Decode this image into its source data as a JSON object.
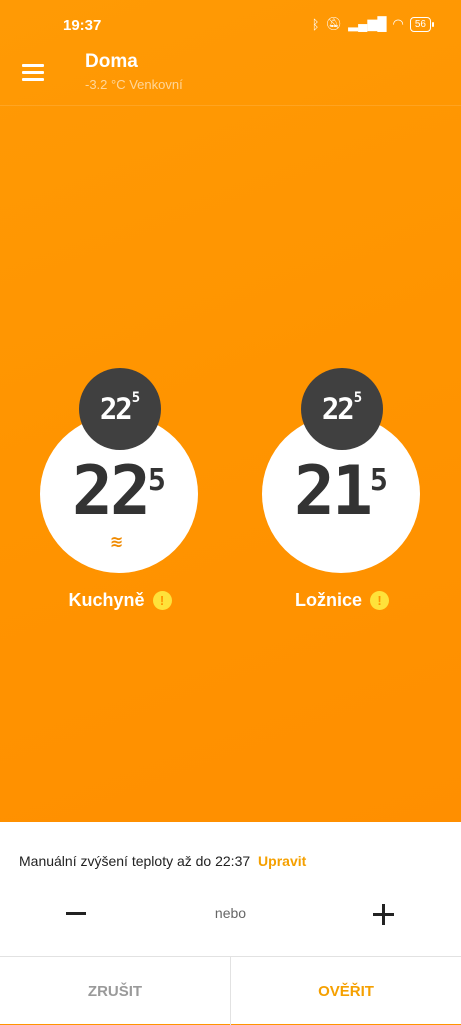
{
  "status_bar": {
    "time": "19:37",
    "icons": [
      "bluetooth-icon",
      "mute-icon",
      "signal-icon",
      "wifi-icon"
    ],
    "battery": "56"
  },
  "header": {
    "title": "Doma",
    "subtitle": "-3.2 °C Venkovní"
  },
  "rooms": [
    {
      "name": "Kuchyně",
      "target_main": "22",
      "target_decimal": "5",
      "current_main": "22",
      "current_decimal": "5",
      "heating_indicator": "≋"
    },
    {
      "name": "Ložnice",
      "target_main": "22",
      "target_decimal": "5",
      "current_main": "21",
      "current_decimal": "5"
    }
  ],
  "warning_symbol": "!",
  "panel": {
    "info_text": "Manuální zvýšení teploty až do 22:37",
    "edit_link": "Upravit",
    "or_text": "nebo",
    "cancel_label": "ZRUŠIT",
    "confirm_label": "OVĚŘIT"
  },
  "colors": {
    "accent": "#ff9400",
    "link": "#f5a000",
    "bubble": "#404040",
    "warning": "#ffe23a"
  }
}
